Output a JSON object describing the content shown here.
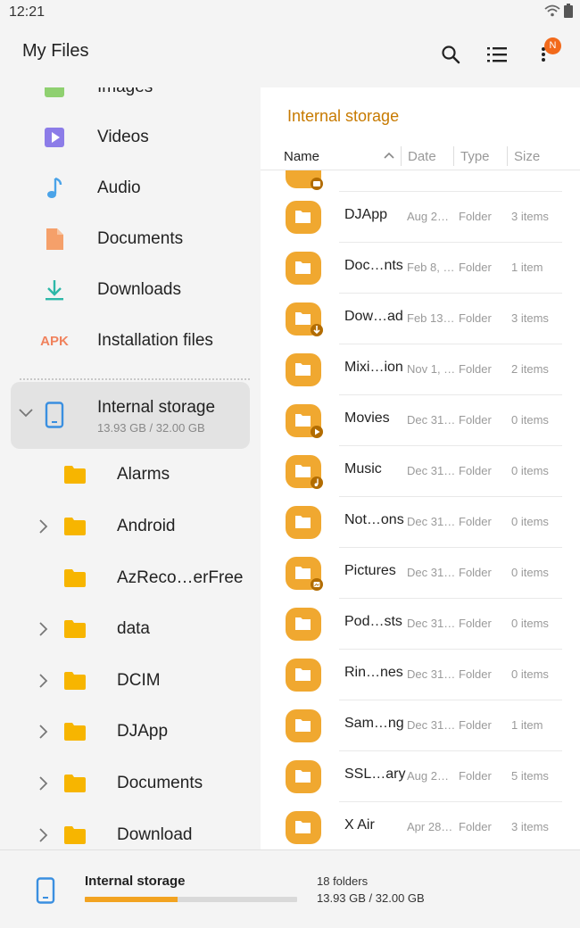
{
  "status_bar": {
    "time": "12:21"
  },
  "app_bar": {
    "title": "My Files",
    "badge": "N",
    "search_icon": "search-icon",
    "list_icon": "list-view-icon",
    "more_icon": "more-vertical-icon"
  },
  "sidebar": {
    "categories": [
      {
        "label": "Images",
        "icon": "images-icon"
      },
      {
        "label": "Videos",
        "icon": "videos-icon"
      },
      {
        "label": "Audio",
        "icon": "audio-icon"
      },
      {
        "label": "Documents",
        "icon": "documents-icon"
      },
      {
        "label": "Downloads",
        "icon": "downloads-icon"
      },
      {
        "label": "Installation files",
        "icon": "apk-icon",
        "icon_text": "APK"
      }
    ],
    "storage": {
      "name": "Internal storage",
      "size": "13.93 GB / 32.00 GB"
    },
    "tree": [
      {
        "label": "Alarms",
        "expandable": false
      },
      {
        "label": "Android",
        "expandable": true
      },
      {
        "label": "AzReco…erFree",
        "expandable": false
      },
      {
        "label": "data",
        "expandable": true
      },
      {
        "label": "DCIM",
        "expandable": true
      },
      {
        "label": "DJApp",
        "expandable": true
      },
      {
        "label": "Documents",
        "expandable": true
      },
      {
        "label": "Download",
        "expandable": true
      }
    ]
  },
  "main": {
    "title": "Internal storage",
    "columns": {
      "name": "Name",
      "date": "Date",
      "type": "Type",
      "size": "Size"
    },
    "files": [
      {
        "name": "DJApp",
        "date": "Aug 2…",
        "type": "Folder",
        "size": "3 items",
        "overlay": ""
      },
      {
        "name": "Doc…nts",
        "date": "Feb 8, …",
        "type": "Folder",
        "size": "1 item",
        "overlay": ""
      },
      {
        "name": "Dow…ad",
        "date": "Feb 13…",
        "type": "Folder",
        "size": "3 items",
        "overlay": "download"
      },
      {
        "name": "Mixi…ion",
        "date": "Nov 1, …",
        "type": "Folder",
        "size": "2 items",
        "overlay": ""
      },
      {
        "name": "Movies",
        "date": "Dec 31…",
        "type": "Folder",
        "size": "0 items",
        "overlay": "play"
      },
      {
        "name": "Music",
        "date": "Dec 31…",
        "type": "Folder",
        "size": "0 items",
        "overlay": "music"
      },
      {
        "name": "Not…ons",
        "date": "Dec 31…",
        "type": "Folder",
        "size": "0 items",
        "overlay": ""
      },
      {
        "name": "Pictures",
        "date": "Dec 31…",
        "type": "Folder",
        "size": "0 items",
        "overlay": "image"
      },
      {
        "name": "Pod…sts",
        "date": "Dec 31…",
        "type": "Folder",
        "size": "0 items",
        "overlay": ""
      },
      {
        "name": "Rin…nes",
        "date": "Dec 31…",
        "type": "Folder",
        "size": "0 items",
        "overlay": ""
      },
      {
        "name": "Sam…ng",
        "date": "Dec 31…",
        "type": "Folder",
        "size": "1 item",
        "overlay": ""
      },
      {
        "name": "SSL…ary",
        "date": "Aug 2…",
        "type": "Folder",
        "size": "5 items",
        "overlay": ""
      },
      {
        "name": "X Air",
        "date": "Apr 28…",
        "type": "Folder",
        "size": "3 items",
        "overlay": ""
      }
    ]
  },
  "bottom_bar": {
    "name": "Internal storage",
    "folders": "18 folders",
    "usage": "13.93 GB / 32.00 GB",
    "used_fraction": 0.435
  },
  "colors": {
    "accent": "#c77a00",
    "folder": "#f0a830",
    "folder_tree": "#f7b500",
    "badge": "#f26a1b",
    "progress": "#f2a321"
  }
}
